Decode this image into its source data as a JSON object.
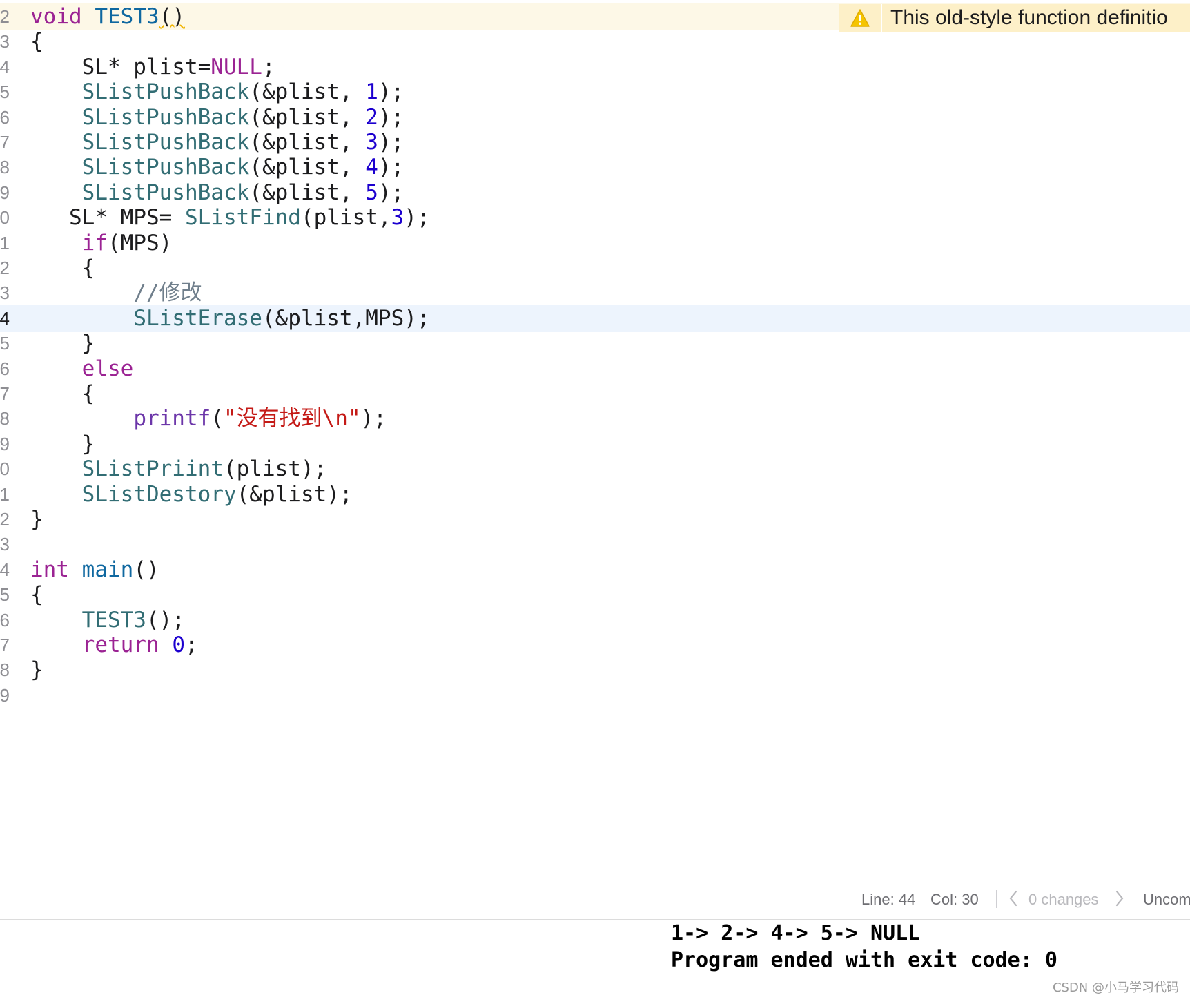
{
  "editor": {
    "lines": [
      {
        "num": "2",
        "current": false,
        "tokens": [
          {
            "t": "void",
            "c": "kw"
          },
          {
            "t": " "
          },
          {
            "t": "TEST3",
            "c": "fnd"
          },
          {
            "t": "()",
            "c": "squig"
          }
        ]
      },
      {
        "num": "3",
        "current": false,
        "tokens": [
          {
            "t": "{"
          }
        ]
      },
      {
        "num": "4",
        "current": false,
        "tokens": [
          {
            "t": "    SL* plist="
          },
          {
            "t": "NULL",
            "c": "kw"
          },
          {
            "t": ";"
          }
        ]
      },
      {
        "num": "5",
        "current": false,
        "tokens": [
          {
            "t": "    "
          },
          {
            "t": "SListPushBack",
            "c": "fn"
          },
          {
            "t": "(&plist, "
          },
          {
            "t": "1",
            "c": "num"
          },
          {
            "t": ");"
          }
        ]
      },
      {
        "num": "6",
        "current": false,
        "tokens": [
          {
            "t": "    "
          },
          {
            "t": "SListPushBack",
            "c": "fn"
          },
          {
            "t": "(&plist, "
          },
          {
            "t": "2",
            "c": "num"
          },
          {
            "t": ");"
          }
        ]
      },
      {
        "num": "7",
        "current": false,
        "tokens": [
          {
            "t": "    "
          },
          {
            "t": "SListPushBack",
            "c": "fn"
          },
          {
            "t": "(&plist, "
          },
          {
            "t": "3",
            "c": "num"
          },
          {
            "t": ");"
          }
        ]
      },
      {
        "num": "8",
        "current": false,
        "tokens": [
          {
            "t": "    "
          },
          {
            "t": "SListPushBack",
            "c": "fn"
          },
          {
            "t": "(&plist, "
          },
          {
            "t": "4",
            "c": "num"
          },
          {
            "t": ");"
          }
        ]
      },
      {
        "num": "9",
        "current": false,
        "tokens": [
          {
            "t": "    "
          },
          {
            "t": "SListPushBack",
            "c": "fn"
          },
          {
            "t": "(&plist, "
          },
          {
            "t": "5",
            "c": "num"
          },
          {
            "t": ");"
          }
        ]
      },
      {
        "num": "0",
        "current": false,
        "tokens": [
          {
            "t": "   SL* MPS= "
          },
          {
            "t": "SListFind",
            "c": "fn"
          },
          {
            "t": "(plist,"
          },
          {
            "t": "3",
            "c": "num"
          },
          {
            "t": ");"
          }
        ]
      },
      {
        "num": "1",
        "current": false,
        "tokens": [
          {
            "t": "    "
          },
          {
            "t": "if",
            "c": "kw"
          },
          {
            "t": "(MPS)"
          }
        ]
      },
      {
        "num": "2",
        "current": false,
        "tokens": [
          {
            "t": "    {"
          }
        ]
      },
      {
        "num": "3",
        "current": false,
        "tokens": [
          {
            "t": "        "
          },
          {
            "t": "//修改",
            "c": "cm"
          }
        ]
      },
      {
        "num": "4",
        "current": true,
        "tokens": [
          {
            "t": "        "
          },
          {
            "t": "SListErase",
            "c": "fn"
          },
          {
            "t": "(&plist,MPS);"
          }
        ]
      },
      {
        "num": "5",
        "current": false,
        "tokens": [
          {
            "t": "    }"
          }
        ]
      },
      {
        "num": "6",
        "current": false,
        "tokens": [
          {
            "t": "    "
          },
          {
            "t": "else",
            "c": "kw"
          }
        ]
      },
      {
        "num": "7",
        "current": false,
        "tokens": [
          {
            "t": "    {"
          }
        ]
      },
      {
        "num": "8",
        "current": false,
        "tokens": [
          {
            "t": "        "
          },
          {
            "t": "printf",
            "c": "lib"
          },
          {
            "t": "("
          },
          {
            "t": "\"没有找到\\n\"",
            "c": "str"
          },
          {
            "t": ");"
          }
        ]
      },
      {
        "num": "9",
        "current": false,
        "tokens": [
          {
            "t": "    }"
          }
        ]
      },
      {
        "num": "0",
        "current": false,
        "tokens": [
          {
            "t": "    "
          },
          {
            "t": "SListPriint",
            "c": "fn"
          },
          {
            "t": "(plist);"
          }
        ]
      },
      {
        "num": "1",
        "current": false,
        "tokens": [
          {
            "t": "    "
          },
          {
            "t": "SListDestory",
            "c": "fn"
          },
          {
            "t": "(&plist);"
          }
        ]
      },
      {
        "num": "2",
        "current": false,
        "tokens": [
          {
            "t": "}"
          }
        ]
      },
      {
        "num": "3",
        "current": false,
        "tokens": []
      },
      {
        "num": "4",
        "current": false,
        "tokens": [
          {
            "t": "int",
            "c": "kw"
          },
          {
            "t": " "
          },
          {
            "t": "main",
            "c": "fnd"
          },
          {
            "t": "()"
          }
        ]
      },
      {
        "num": "5",
        "current": false,
        "tokens": [
          {
            "t": "{"
          }
        ]
      },
      {
        "num": "6",
        "current": false,
        "tokens": [
          {
            "t": "    "
          },
          {
            "t": "TEST3",
            "c": "fn"
          },
          {
            "t": "();"
          }
        ]
      },
      {
        "num": "7",
        "current": false,
        "tokens": [
          {
            "t": "    "
          },
          {
            "t": "return",
            "c": "kw"
          },
          {
            "t": " "
          },
          {
            "t": "0",
            "c": "num"
          },
          {
            "t": ";"
          }
        ]
      },
      {
        "num": "8",
        "current": false,
        "tokens": [
          {
            "t": "}"
          }
        ]
      },
      {
        "num": "9",
        "current": false,
        "tokens": []
      }
    ],
    "warning": {
      "icon": "warning-triangle-icon",
      "message": "This old-style function definitio"
    }
  },
  "statusbar": {
    "line_label": "Line: 44",
    "col_label": "Col: 30",
    "prev_icon": "chevron-left-icon",
    "changes_label": "0 changes",
    "next_icon": "chevron-right-icon",
    "encoding_label": "Uncom"
  },
  "console": {
    "output_line1": "1-> 2-> 4-> 5-> NULL",
    "output_line2": "Program ended with exit code: 0"
  },
  "watermark": "CSDN @小马学习代码",
  "colors": {
    "keyword": "#9b2393",
    "function": "#326d74",
    "number": "#1c00cf",
    "string": "#c41a16",
    "comment": "#707f8c",
    "current_line": "#edf4fd",
    "warning_bg": "#fdf0c8"
  }
}
